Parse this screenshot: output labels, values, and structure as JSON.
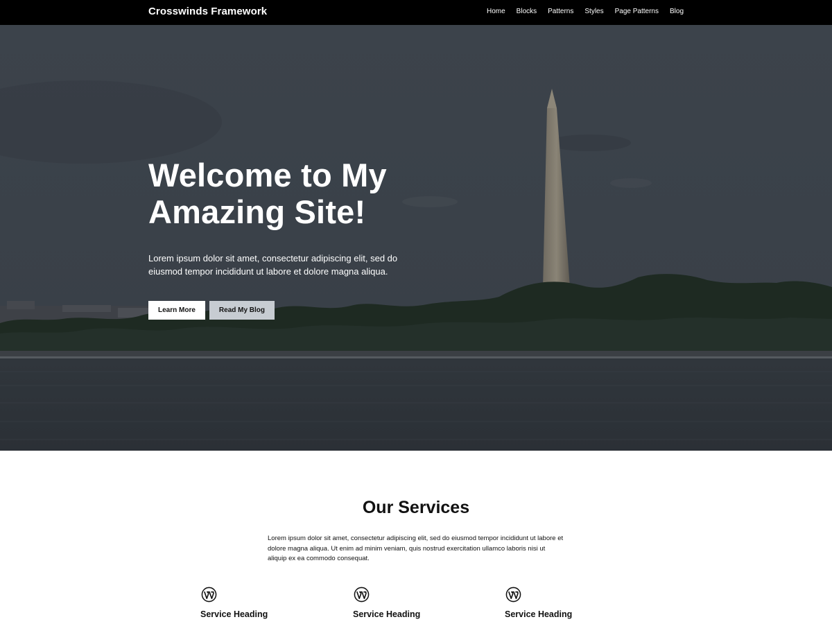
{
  "header": {
    "site_title": "Crosswinds Framework",
    "nav": [
      "Home",
      "Blocks",
      "Patterns",
      "Styles",
      "Page Patterns",
      "Blog"
    ]
  },
  "hero": {
    "title_line1": "Welcome to My",
    "title_line2": "Amazing Site!",
    "text": "Lorem ipsum dolor sit amet, consectetur adipiscing elit, sed do eiusmod tempor incididunt ut labore et dolore magna aliqua.",
    "button_primary": "Learn More",
    "button_secondary": "Read My Blog"
  },
  "services": {
    "title": "Our Services",
    "text": "Lorem ipsum dolor sit amet, consectetur adipiscing elit, sed do eiusmod tempor incididunt ut labore et dolore magna aliqua. Ut enim ad minim veniam, quis nostrud exercitation ullamco laboris nisi ut aliquip ex ea commodo consequat.",
    "items": [
      {
        "icon": "wordpress-icon",
        "heading": "Service Heading"
      },
      {
        "icon": "wordpress-icon",
        "heading": "Service Heading"
      },
      {
        "icon": "wordpress-icon",
        "heading": "Service Heading"
      }
    ]
  },
  "colors": {
    "topbar": "#000000",
    "hero_overlay": "#3a4048",
    "button_secondary": "#c7ccd2",
    "text_dark": "#111111"
  }
}
